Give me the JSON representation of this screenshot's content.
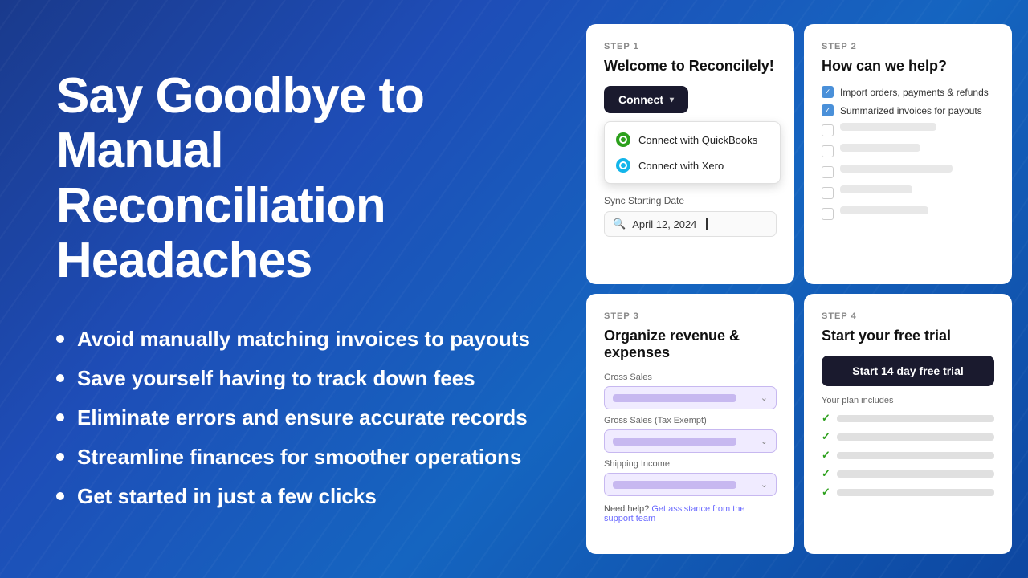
{
  "background": {
    "gradient_start": "#1a3a8c",
    "gradient_end": "#0d47a1"
  },
  "left": {
    "headline_line1": "Say Goodbye to Manual",
    "headline_line2": "Reconciliation Headaches",
    "bullets": [
      "Avoid manually matching invoices to payouts",
      "Save yourself having to track down fees",
      "Eliminate errors and ensure accurate records",
      "Streamline finances for smoother operations",
      "Get started in just a few clicks"
    ]
  },
  "step1": {
    "step_label": "STEP 1",
    "title": "Welcome to Reconcilely!",
    "connect_btn": "Connect",
    "dropdown_qb": "Connect with QuickBooks",
    "dropdown_xero": "Connect with Xero",
    "sync_label": "Sync Starting Date",
    "date_value": "April 12, 2024"
  },
  "step2": {
    "step_label": "STEP 2",
    "title": "How can we help?",
    "checked_items": [
      "Import orders, payments & refunds",
      "Summarized invoices for payouts"
    ],
    "unchecked_count": 5
  },
  "step3": {
    "step_label": "STEP 3",
    "title": "Organize revenue & expenses",
    "fields": [
      "Gross Sales",
      "Gross Sales (Tax Exempt)",
      "Shipping Income"
    ],
    "help_text": "Need help?",
    "help_link": "Get assistance from the support team"
  },
  "step4": {
    "step_label": "STEP 4",
    "title": "Start your free trial",
    "trial_btn": "Start 14 day free trial",
    "plan_label": "Your plan includes",
    "plan_items_count": 5
  }
}
